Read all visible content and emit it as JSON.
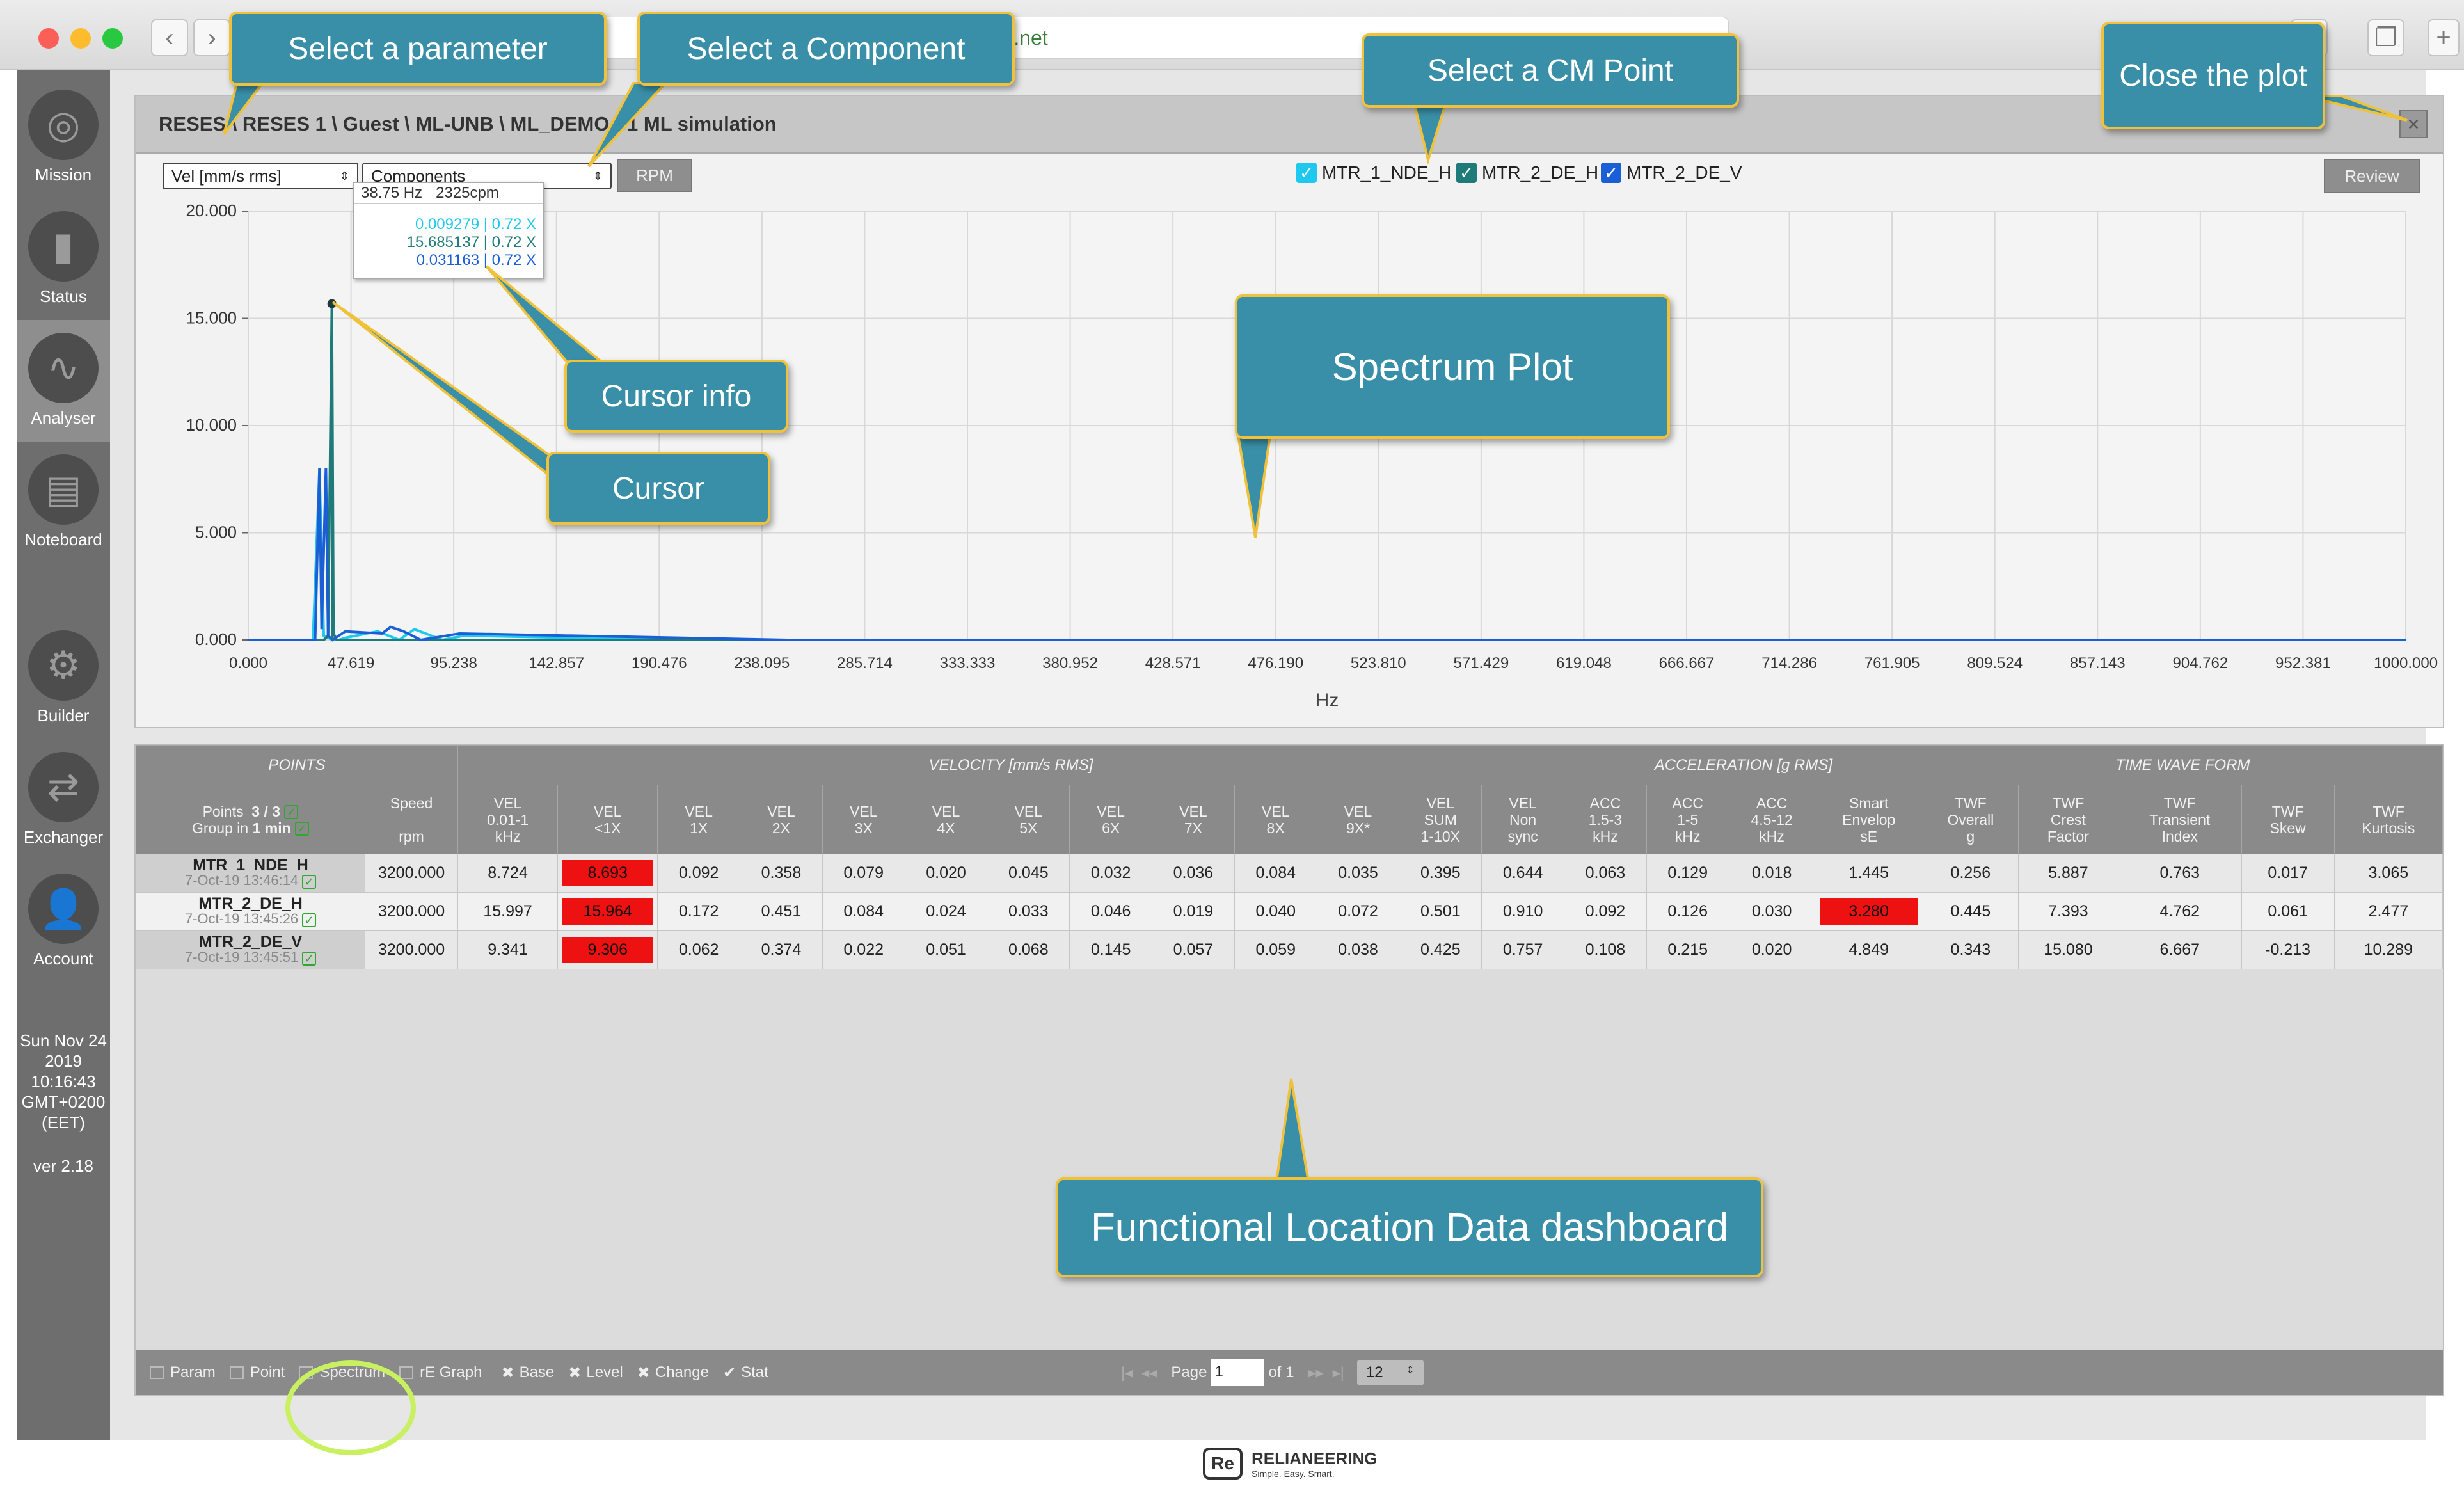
{
  "browser": {
    "url": "reses.net"
  },
  "sidebar": {
    "items": [
      {
        "label": "Mission"
      },
      {
        "label": "Status"
      },
      {
        "label": "Analyser"
      },
      {
        "label": "Noteboard"
      },
      {
        "label": "Builder"
      },
      {
        "label": "Exchanger"
      },
      {
        "label": "Account"
      }
    ],
    "date_line1": "Sun Nov 24",
    "date_line2": "2019",
    "time": "10:16:43",
    "tz_line1": "GMT+0200",
    "tz_line2": "(EET)",
    "version": "ver 2.18"
  },
  "plot": {
    "breadcrumb": "RESES \\ RESES 1 \\ Guest \\ ML-UNB \\ ML_DEMO-01 ML simulation",
    "parameter_select": "Vel [mm/s rms]",
    "component_select": "Components",
    "rpm_button": "RPM",
    "review_button": "Review",
    "close_symbol": "×",
    "cm_points": [
      "MTR_1_NDE_H",
      "MTR_2_DE_H",
      "MTR_2_DE_V"
    ],
    "cursor_info": {
      "freq": "38.75 Hz",
      "cpm": "2325cpm",
      "rows": [
        "0.009279 | 0.72 X",
        "15.685137 | 0.72 X",
        "0.031163 | 0.72 X"
      ]
    }
  },
  "chart_data": {
    "type": "line",
    "xlabel": "Hz",
    "ylabel": "",
    "xlim": [
      0,
      1000
    ],
    "ylim": [
      0,
      20
    ],
    "x_ticks": [
      "0.000",
      "47.619",
      "95.238",
      "142.857",
      "190.476",
      "238.095",
      "285.714",
      "333.333",
      "380.952",
      "428.571",
      "476.190",
      "523.810",
      "571.429",
      "619.048",
      "666.667",
      "714.286",
      "761.905",
      "809.524",
      "857.143",
      "904.762",
      "952.381",
      "1000.000"
    ],
    "y_ticks": [
      "0.000",
      "5.000",
      "10.000",
      "15.000",
      "20.000"
    ],
    "grid": true,
    "series": [
      {
        "name": "MTR_1_NDE_H",
        "color": "#1ec8ee",
        "x": [
          0,
          30,
          33,
          35,
          37,
          39,
          40,
          42,
          45,
          60,
          70,
          77,
          90,
          100,
          200,
          1000
        ],
        "y": [
          0,
          0,
          8.0,
          0.2,
          0.1,
          0.009,
          0.0,
          0.0,
          0.1,
          0.4,
          0.0,
          0.5,
          0.0,
          0.2,
          0.0,
          0.0
        ]
      },
      {
        "name": "MTR_2_DE_H",
        "color": "#1f7a7a",
        "x": [
          0,
          35,
          37,
          38.75,
          39.5,
          41,
          60,
          1000
        ],
        "y": [
          0,
          0,
          0.2,
          15.685,
          0.3,
          0,
          0,
          0
        ]
      },
      {
        "name": "MTR_2_DE_V",
        "color": "#1a5fd6",
        "x": [
          0,
          31,
          33,
          34,
          36,
          37,
          38.75,
          39,
          45,
          62,
          66,
          72,
          80,
          98,
          250,
          1000
        ],
        "y": [
          0,
          0,
          8.0,
          0.5,
          8.0,
          0.2,
          0.031,
          0,
          0.4,
          0.3,
          0.6,
          0.4,
          0.0,
          0.3,
          0.0,
          0.0
        ]
      }
    ]
  },
  "table": {
    "groups": [
      "POINTS",
      "VELOCITY [mm/s RMS]",
      "ACCELERATION [g RMS]",
      "TIME WAVE FORM"
    ],
    "points_header_line1": "Points",
    "points_count": "3 / 3",
    "points_header_line2": "Group in",
    "group_time": "1 min",
    "speed_header": [
      "Speed",
      "rpm"
    ],
    "columns": [
      [
        "VEL",
        "0.01-1",
        "kHz"
      ],
      [
        "VEL",
        "<1X",
        ""
      ],
      [
        "VEL",
        "1X",
        ""
      ],
      [
        "VEL",
        "2X",
        ""
      ],
      [
        "VEL",
        "3X",
        ""
      ],
      [
        "VEL",
        "4X",
        ""
      ],
      [
        "VEL",
        "5X",
        ""
      ],
      [
        "VEL",
        "6X",
        ""
      ],
      [
        "VEL",
        "7X",
        ""
      ],
      [
        "VEL",
        "8X",
        ""
      ],
      [
        "VEL",
        "9X*",
        ""
      ],
      [
        "VEL",
        "SUM",
        "1-10X"
      ],
      [
        "VEL",
        "Non",
        "sync"
      ],
      [
        "ACC",
        "1.5-3",
        "kHz"
      ],
      [
        "ACC",
        "1-5",
        "kHz"
      ],
      [
        "ACC",
        "4.5-12",
        "kHz"
      ],
      [
        "Smart",
        "Envelop",
        "sE"
      ],
      [
        "TWF",
        "Overall",
        "g"
      ],
      [
        "TWF",
        "Crest",
        "Factor"
      ],
      [
        "TWF",
        "Transient",
        "Index"
      ],
      [
        "TWF",
        "Skew",
        ""
      ],
      [
        "TWF",
        "Kurtosis",
        ""
      ]
    ],
    "rows": [
      {
        "name": "MTR_1_NDE_H",
        "date": "7-Oct-19 13:46:14",
        "speed": "3200.000",
        "values": [
          "8.724",
          "8.693",
          "0.092",
          "0.358",
          "0.079",
          "0.020",
          "0.045",
          "0.032",
          "0.036",
          "0.084",
          "0.035",
          "0.395",
          "0.644",
          "0.063",
          "0.129",
          "0.018",
          "1.445",
          "0.256",
          "5.887",
          "0.763",
          "0.017",
          "3.065"
        ],
        "alarms": [
          1
        ]
      },
      {
        "name": "MTR_2_DE_H",
        "date": "7-Oct-19 13:45:26",
        "speed": "3200.000",
        "values": [
          "15.997",
          "15.964",
          "0.172",
          "0.451",
          "0.084",
          "0.024",
          "0.033",
          "0.046",
          "0.019",
          "0.040",
          "0.072",
          "0.501",
          "0.910",
          "0.092",
          "0.126",
          "0.030",
          "3.280",
          "0.445",
          "7.393",
          "4.762",
          "0.061",
          "2.477"
        ],
        "alarms": [
          1,
          16
        ]
      },
      {
        "name": "MTR_2_DE_V",
        "date": "7-Oct-19 13:45:51",
        "speed": "3200.000",
        "values": [
          "9.341",
          "9.306",
          "0.062",
          "0.374",
          "0.022",
          "0.051",
          "0.068",
          "0.145",
          "0.057",
          "0.059",
          "0.038",
          "0.425",
          "0.757",
          "0.108",
          "0.215",
          "0.020",
          "4.849",
          "0.343",
          "15.080",
          "6.667",
          "-0.213",
          "10.289"
        ],
        "alarms": [
          1
        ]
      }
    ],
    "footer": {
      "items": [
        "Param",
        "Point",
        "Spectrum",
        "rE Graph",
        "Base",
        "Level",
        "Change",
        "Stat"
      ],
      "page_label": "Page",
      "page_value": "1",
      "of_label": "of 1",
      "per_page": "12"
    }
  },
  "callouts": {
    "select_parameter": "Select a parameter",
    "select_component": "Select a Component",
    "select_cm_point": "Select a CM Point",
    "close_plot": "Close the plot",
    "cursor_info": "Cursor info",
    "cursor": "Cursor",
    "spectrum_plot": "Spectrum Plot",
    "dashboard": "Functional Location Data dashboard"
  },
  "brand": {
    "name": "RELIANEERING",
    "tagline": "Simple. Easy. Smart."
  },
  "colors": {
    "accent": "#3a8fa8",
    "callout_border": "#f0c23c",
    "alarm": "#ee1111",
    "highlight_ring": "#c8f060"
  }
}
